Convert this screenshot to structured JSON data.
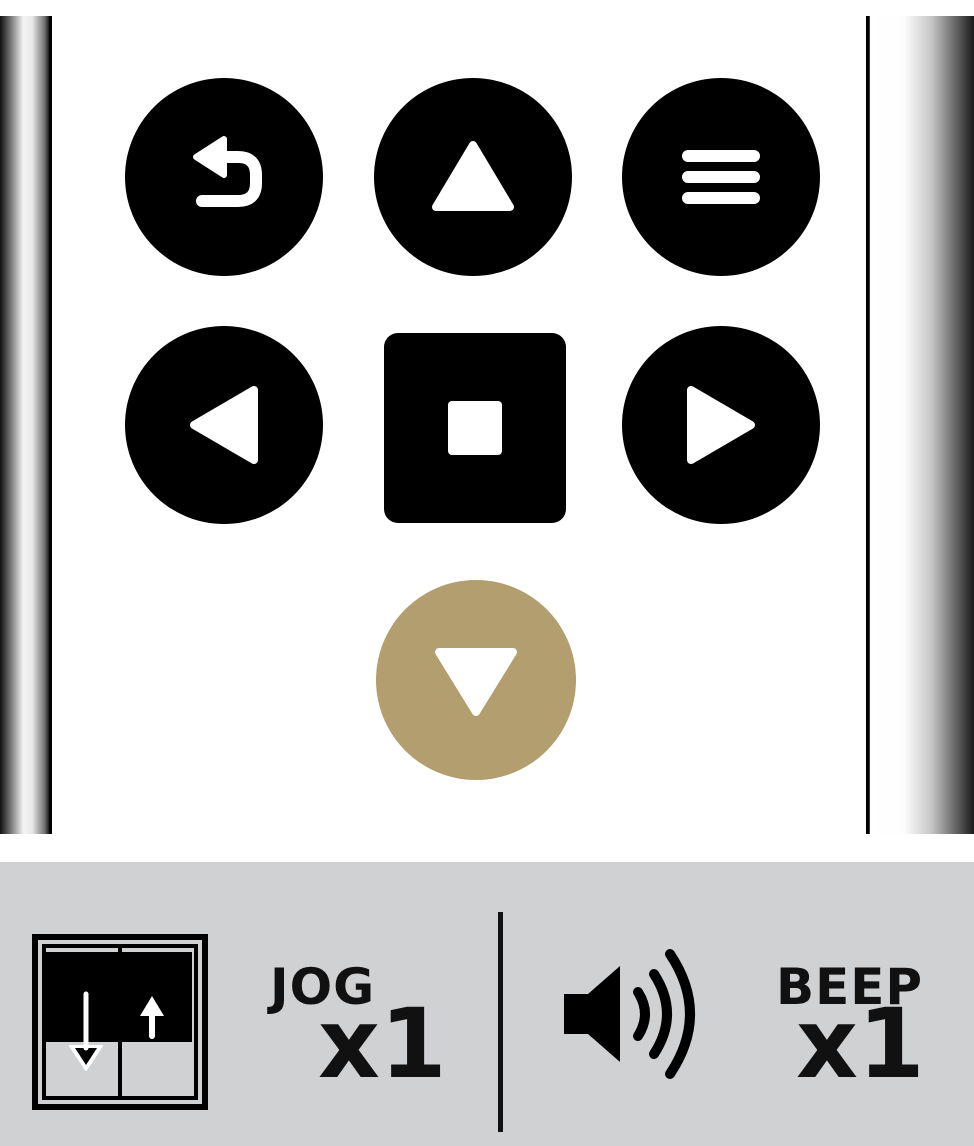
{
  "remote": {
    "buttons": [
      {
        "name": "back-button",
        "icon": "back-arrow-icon"
      },
      {
        "name": "up-button",
        "icon": "triangle-up-icon"
      },
      {
        "name": "menu-button",
        "icon": "menu-icon"
      },
      {
        "name": "left-button",
        "icon": "triangle-left-icon"
      },
      {
        "name": "stop-button",
        "icon": "stop-icon"
      },
      {
        "name": "right-button",
        "icon": "triangle-right-icon"
      },
      {
        "name": "down-button",
        "icon": "triangle-down-icon",
        "highlighted": true
      }
    ],
    "colors": {
      "button": "#000000",
      "highlight": "#b39e6f",
      "icon": "#ffffff",
      "status_bg": "#d0d1d3"
    }
  },
  "status": {
    "jog": {
      "label": "JOG",
      "count": "x1",
      "icon": "double-hung-window-icon"
    },
    "beep": {
      "label": "BEEP",
      "count": "x1",
      "icon": "speaker-volume-icon"
    }
  }
}
